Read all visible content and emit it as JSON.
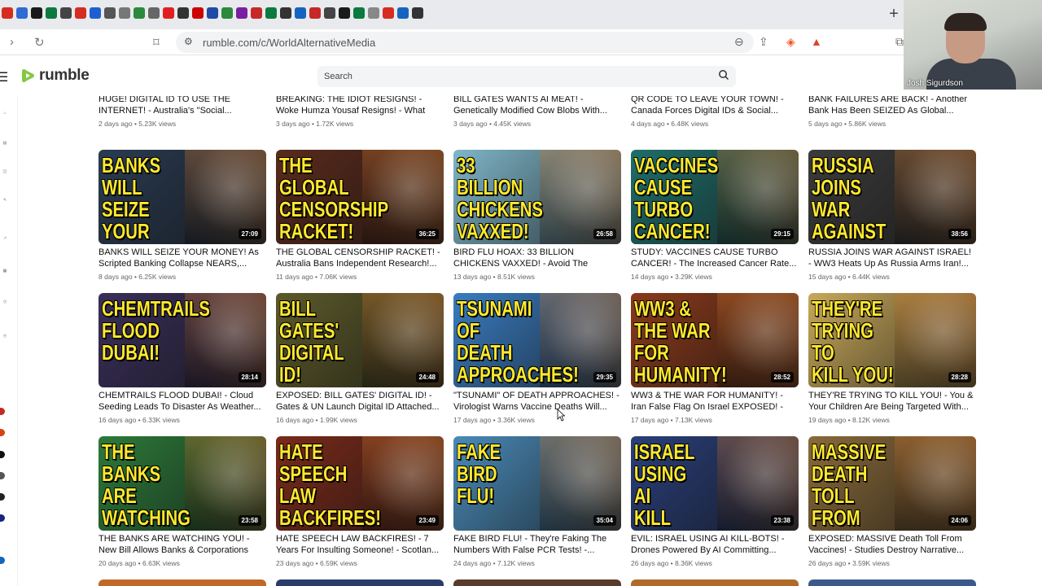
{
  "browser": {
    "url": "rumble.com/c/WorldAlternativeMedia",
    "new_tab_label": "+",
    "favicons": [
      {
        "icon": "tab-favicon",
        "color": "#d62d20"
      },
      {
        "icon": "tab-favicon",
        "color": "#2f6bd4"
      },
      {
        "icon": "tab-favicon",
        "color": "#1a1a1a"
      },
      {
        "icon": "tab-favicon",
        "color": "#0b7a3e"
      },
      {
        "icon": "tab-favicon",
        "color": "#444444"
      },
      {
        "icon": "tab-favicon",
        "color": "#d62d20"
      },
      {
        "icon": "tab-favicon",
        "color": "#1d5fd1"
      },
      {
        "icon": "tab-favicon",
        "color": "#555555"
      },
      {
        "icon": "tab-favicon",
        "color": "#777777"
      },
      {
        "icon": "tab-favicon",
        "color": "#2b8a3e"
      },
      {
        "icon": "tab-favicon",
        "color": "#666666"
      },
      {
        "icon": "tab-favicon",
        "color": "#e02020"
      },
      {
        "icon": "tab-favicon",
        "color": "#333333"
      },
      {
        "icon": "tab-favicon",
        "color": "#cc0000"
      },
      {
        "icon": "tab-favicon",
        "color": "#1f4aa8"
      },
      {
        "icon": "tab-favicon",
        "color": "#2b8a3e"
      },
      {
        "icon": "tab-favicon",
        "color": "#7a1fa2"
      },
      {
        "icon": "tab-favicon",
        "color": "#c62828"
      },
      {
        "icon": "tab-favicon",
        "color": "#0b7a3e"
      },
      {
        "icon": "tab-favicon",
        "color": "#333333"
      },
      {
        "icon": "tab-favicon",
        "color": "#1565c0"
      },
      {
        "icon": "tab-favicon",
        "color": "#c62828"
      },
      {
        "icon": "tab-favicon",
        "color": "#444444"
      },
      {
        "icon": "tab-favicon",
        "color": "#1a1a1a"
      },
      {
        "icon": "tab-favicon",
        "color": "#0b7a3e"
      },
      {
        "icon": "tab-favicon",
        "color": "#888888"
      },
      {
        "icon": "tab-favicon",
        "color": "#d62d20"
      },
      {
        "icon": "tab-favicon",
        "color": "#1565c0"
      },
      {
        "icon": "tab-favicon",
        "color": "#333333"
      }
    ]
  },
  "webcam": {
    "name": "Josh Sigurdson"
  },
  "site": {
    "logo_text": "rumble",
    "brand_color": "#85c742",
    "search_placeholder": "Search"
  },
  "top_row": [
    {
      "title": "HUGE! DIGITAL ID TO USE THE INTERNET! - Australia's \"Social...",
      "meta": "2 days ago • 5.23K views"
    },
    {
      "title": "BREAKING: THE IDIOT RESIGNS! - Woke Humza Yousaf Resigns! - What WEF...",
      "meta": "3 days ago • 1.72K views"
    },
    {
      "title": "BILL GATES WANTS AI MEAT! - Genetically Modified Cow Blobs With...",
      "meta": "3 days ago • 4.45K views"
    },
    {
      "title": "QR CODE TO LEAVE YOUR TOWN! - Canada Forces Digital IDs & Social...",
      "meta": "4 days ago • 6.48K views"
    },
    {
      "title": "BANK FAILURES ARE BACK! - Another Bank Has Been SEIZED As Global...",
      "meta": "5 days ago • 5.86K views"
    }
  ],
  "videos": [
    {
      "thumb_text": "BANKS\nWILL SEIZE\nYOUR\nMONEY!",
      "bg": "#2a3b52",
      "duration": "27:09",
      "title": "BANKS WILL SEIZE YOUR MONEY! As Scripted Banking Collapse NEARS,...",
      "meta": "8 days ago • 6.25K views"
    },
    {
      "thumb_text": "THE\nGLOBAL\nCENSORSHIP\nRACKET!",
      "bg": "#5a2a1c",
      "duration": "36:25",
      "title": "THE GLOBAL CENSORSHIP RACKET! - Australia Bans Independent Research!...",
      "meta": "11 days ago • 7.06K views"
    },
    {
      "thumb_text": "33\nBILLION\nCHICKENS\nVAXXED!",
      "bg": "#7fb6c9",
      "duration": "26:58",
      "title": "BIRD FLU HOAX: 33 BILLION CHICKENS VAXXED! - Avoid The Pharma Poisone...",
      "meta": "13 days ago • 8.51K views"
    },
    {
      "thumb_text": "VACCINES\nCAUSE\nTURBO\nCANCER!",
      "bg": "#1f6e6a",
      "duration": "29:15",
      "title": "STUDY: VACCINES CAUSE TURBO CANCER! - The Increased Cancer Rate...",
      "meta": "14 days ago • 3.29K views"
    },
    {
      "thumb_text": "RUSSIA\nJOINS\nWAR\nAGAINST ISRAEL!",
      "bg": "#3b3b3b",
      "duration": "38:56",
      "title": "RUSSIA JOINS WAR AGAINST ISRAEL! - WW3 Heats Up As Russia Arms Iran!...",
      "meta": "15 days ago • 6.44K views"
    },
    {
      "thumb_text": "CHEMTRAILS\nFLOOD\nDUBAI!",
      "bg": "#3a2f5a",
      "duration": "28:14",
      "title": "CHEMTRAILS FLOOD DUBAI! - Cloud Seeding Leads To Disaster As Weather...",
      "meta": "16 days ago • 6.33K views"
    },
    {
      "thumb_text": "BILL\nGATES'\nDIGITAL\nID!",
      "bg": "#5c5a2a",
      "duration": "24:48",
      "title": "EXPOSED: BILL GATES' DIGITAL ID! - Gates & UN Launch Digital ID Attached...",
      "meta": "16 days ago • 1.99K views"
    },
    {
      "thumb_text": "TSUNAMI\nOF\nDEATH\nAPPROACHES!",
      "bg": "#3a7cc0",
      "duration": "29:35",
      "title": "\"TSUNAMI\" OF DEATH APPROACHES! - Virologist Warns Vaccine Deaths Will...",
      "meta": "17 days ago • 3.36K views"
    },
    {
      "thumb_text": "WW3 &\nTHE WAR\nFOR\nHUMANITY!",
      "bg": "#8a3a1a",
      "duration": "28:52",
      "title": "WW3 & THE WAR FOR HUMANITY! - Iran False Flag On Israel EXPOSED! - Who...",
      "meta": "17 days ago • 7.13K views"
    },
    {
      "thumb_text": "THEY'RE\nTRYING\nTO\nKILL YOU!",
      "bg": "#c8a85a",
      "duration": "28:28",
      "title": "THEY'RE TRYING TO KILL YOU! - You & Your Children Are Being Targeted With...",
      "meta": "19 days ago • 8.12K views"
    },
    {
      "thumb_text": "THE BANKS\nARE\nWATCHING\nYOU!",
      "bg": "#2d7a3a",
      "duration": "23:58",
      "title": "THE BANKS ARE WATCHING YOU! - New Bill Allows Banks & Corporations To...",
      "meta": "20 days ago • 6.63K views"
    },
    {
      "thumb_text": "HATE\nSPEECH\nLAW\nBACKFIRES!",
      "bg": "#7a2a1a",
      "duration": "23:49",
      "title": "HATE SPEECH LAW BACKFIRES! - 7 Years For Insulting Someone! - Scotlan...",
      "meta": "23 days ago • 6.59K views"
    },
    {
      "thumb_text": "FAKE\nBIRD\nFLU!",
      "bg": "#4a8ab8",
      "duration": "35:04",
      "title": "FAKE BIRD FLU! - They're Faking The Numbers With False PCR Tests! -...",
      "meta": "24 days ago • 7.12K views"
    },
    {
      "thumb_text": "ISRAEL\nUSING\nAI\nKILL BOTS!",
      "bg": "#2a3f7a",
      "duration": "23:38",
      "title": "EVIL: ISRAEL USING AI KILL-BOTS! - Drones Powered By AI Committing...",
      "meta": "26 days ago • 8.36K views"
    },
    {
      "thumb_text": "MASSIVE\nDEATH TOLL\nFROM\nVACCINES!",
      "bg": "#8a6a3a",
      "duration": "24:06",
      "title": "EXPOSED: MASSIVE Death Toll From Vaccines! - Studies Destroy Narrative...",
      "meta": "26 days ago • 3.59K views"
    }
  ],
  "bottom_row_colors": [
    "#c0692a",
    "#2a3d6a",
    "#5a3a2a",
    "#b06a2a",
    "#3a5a8a"
  ]
}
